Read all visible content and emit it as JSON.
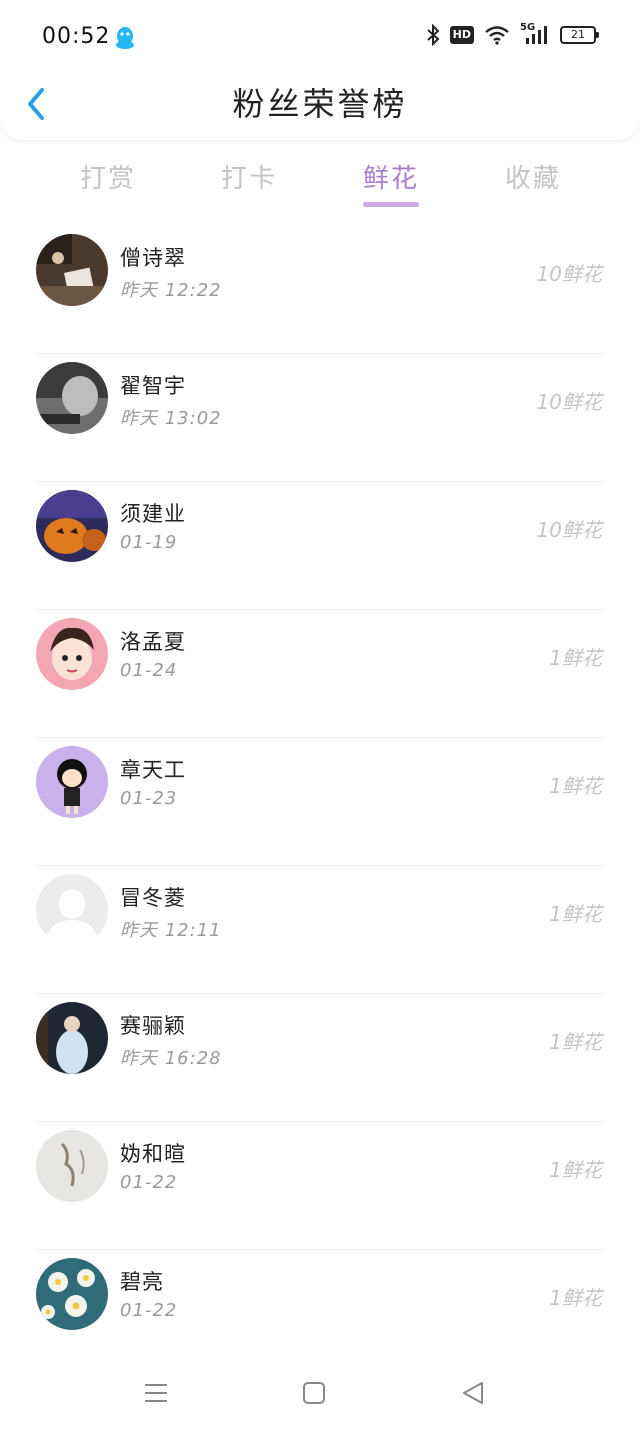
{
  "status_bar": {
    "time": "00:52",
    "network": "5G",
    "hd": "HD",
    "battery": "21"
  },
  "header": {
    "title": "粉丝荣誉榜"
  },
  "tabs": [
    {
      "label": "打赏",
      "active": false
    },
    {
      "label": "打卡",
      "active": false
    },
    {
      "label": "鲜花",
      "active": true
    },
    {
      "label": "收藏",
      "active": false
    }
  ],
  "fans": [
    {
      "name": "僧诗翠",
      "time": "昨天 12:22",
      "amount": "10鲜花",
      "avatar": "photo-dark-room"
    },
    {
      "name": "翟智宇",
      "time": "昨天 13:02",
      "amount": "10鲜花",
      "avatar": "photo-grayscale"
    },
    {
      "name": "须建业",
      "time": "01-19",
      "amount": "10鲜花",
      "avatar": "pumpkin-halloween"
    },
    {
      "name": "洛孟夏",
      "time": "01-24",
      "amount": "1鲜花",
      "avatar": "anime-boy"
    },
    {
      "name": "章天工",
      "time": "01-23",
      "amount": "1鲜花",
      "avatar": "cartoon-girl-purple"
    },
    {
      "name": "冒冬菱",
      "time": "昨天 12:11",
      "amount": "1鲜花",
      "avatar": "default-silhouette"
    },
    {
      "name": "赛骊颖",
      "time": "昨天 16:28",
      "amount": "1鲜花",
      "avatar": "photo-person-dark"
    },
    {
      "name": "妫和暄",
      "time": "01-22",
      "amount": "1鲜花",
      "avatar": "sketch-light"
    },
    {
      "name": "碧亮",
      "time": "01-22",
      "amount": "1鲜花",
      "avatar": "daisy-flowers"
    }
  ],
  "colors": {
    "accent": "#a97fd0",
    "indicator": "#c9a9e6",
    "back_arrow": "#2a9fe6",
    "muted": "#c4c4c4"
  }
}
